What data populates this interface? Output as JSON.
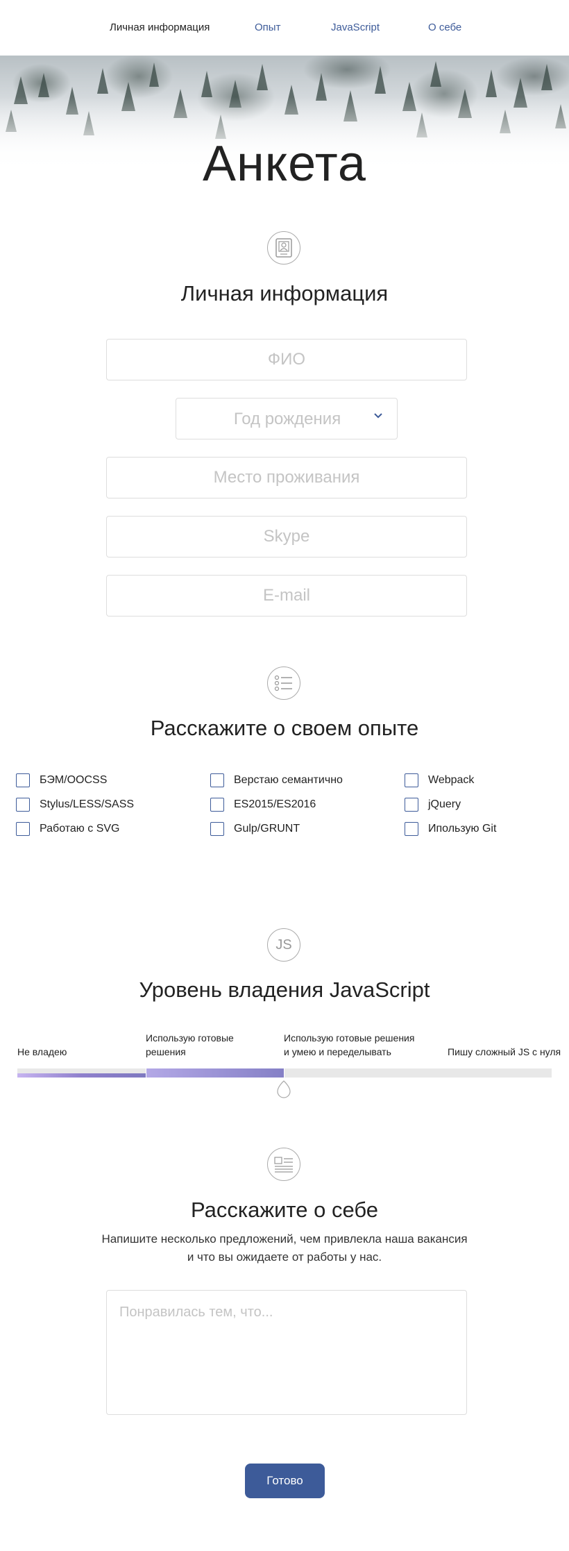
{
  "nav": {
    "items": [
      {
        "label": "Личная информация",
        "active": true
      },
      {
        "label": "Опыт",
        "active": false
      },
      {
        "label": "JavaScript",
        "active": false
      },
      {
        "label": "О себе",
        "active": false
      }
    ]
  },
  "hero": {
    "title": "Анкета"
  },
  "personal": {
    "title": "Личная информация",
    "icon": "id-card-icon",
    "fio_placeholder": "ФИО",
    "birth_year_placeholder": "Год рождения",
    "city_placeholder": "Место проживания",
    "skype_placeholder": "Skype",
    "email_placeholder": "E-mail"
  },
  "experience": {
    "title": "Расскажите о своем опыте",
    "icon": "list-icon",
    "items": [
      "БЭМ/OOCSS",
      "Верстаю семантично",
      "Webpack",
      "Stylus/LESS/SASS",
      "ES2015/ES2016",
      "jQuery",
      "Работаю с SVG",
      "Gulp/GRUNT",
      "Ипользую Git"
    ]
  },
  "javascript": {
    "title": "Уровень владения JavaScript",
    "icon": "js-icon",
    "icon_text": "JS",
    "levels": [
      "Не владею",
      "Использую готовые решения",
      "Использую готовые решения и умею и переделывать",
      "Пишу сложный JS с нуля"
    ],
    "level_line1": [
      "Не владею",
      "Использую готовые",
      "Использую готовые решения",
      "Пишу сложный JS с нуля"
    ],
    "level_line2": [
      "",
      "решения",
      "и умею и переделывать",
      ""
    ],
    "selected_level": 3
  },
  "about": {
    "title": "Расскажите о себе",
    "icon": "profile-card-icon",
    "subtitle_line1": "Напишите несколько предложений, чем привлекла наша вакансия",
    "subtitle_line2": "и что вы ожидаете от работы у нас.",
    "placeholder": "Понравилась тем, что..."
  },
  "submit": {
    "label": "Готово"
  },
  "colors": {
    "accent": "#3d5b99",
    "slider": "#8580c6"
  }
}
